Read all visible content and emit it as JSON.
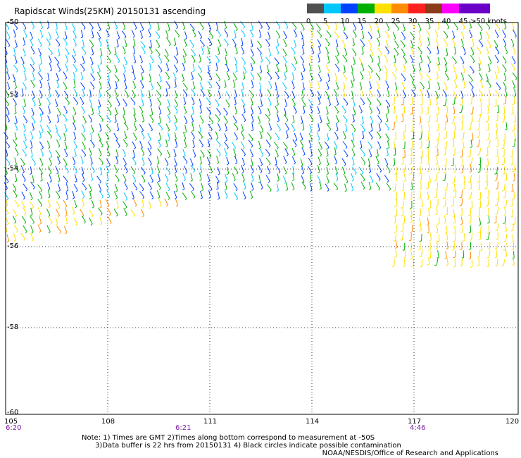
{
  "title": "Rapidscat Winds(25KM) 20150131 ascending",
  "legend": {
    "labels": [
      "0",
      "5",
      "10",
      "15",
      "20",
      "25",
      "30",
      "35",
      "40",
      "45",
      ">50 knots"
    ],
    "colors": [
      "#505050",
      "#00c8ff",
      "#0040ff",
      "#00b000",
      "#ffe000",
      "#ff8c00",
      "#ff2020",
      "#8b3a1a",
      "#ff00ff",
      "#6a00c8"
    ]
  },
  "lat_labels": [
    "-50",
    "-52",
    "-54",
    "-56",
    "-58",
    "-60"
  ],
  "lon_labels": [
    "105",
    "108",
    "111",
    "114",
    "117",
    "120"
  ],
  "time_labels": [
    "6:20",
    "6:21",
    "4:46"
  ],
  "notes": "Note: 1) Times are GMT 2)Times along bottom correspond to measurement at -50S\n      3)Data buffer is 22 hrs from 20150131 4) Black circles indicate possible contamination",
  "credit": "NOAA/NESDIS/Office of Research and Applications",
  "colors": {
    "grid": "#000000",
    "time_label": "#7a1fa0"
  }
}
